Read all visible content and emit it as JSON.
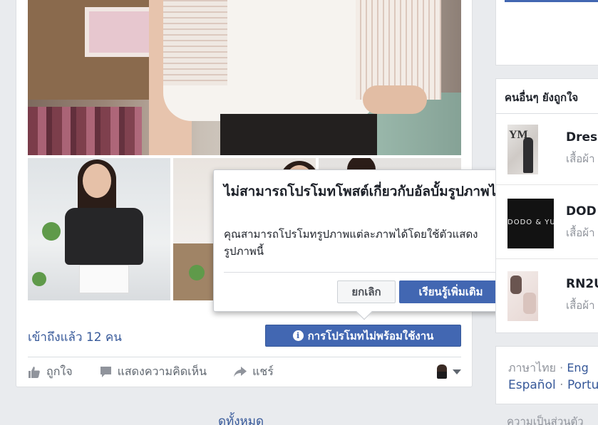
{
  "post": {
    "reach_text": "เข้าถึงแล้ว 12 คน",
    "promote_button": "การโปรโมทไม่พร้อมใช้งาน",
    "actions": {
      "like": "ถูกใจ",
      "comment": "แสดงความคิดเห็น",
      "share": "แชร์"
    },
    "see_all": "ดูทั้งหมด"
  },
  "popover": {
    "title": "ไม่สามารถโปรโมทโพสต์เกี่ยวกับอัลบั้มรูปภาพได้",
    "body": "คุณสามารถโปรโมทรูปภาพแต่ละภาพได้โดยใช้ตัวแสดงรูปภาพนี้",
    "cancel": "ยกเลิก",
    "learn_more": "เรียนรู้เพิ่มเติม"
  },
  "sidebar": {
    "pages_header": "คนอื่นๆ ยังถูกใจ",
    "pages": [
      {
        "name": "Dres",
        "sub": "เสื้อผ้า",
        "thumb_text": "YM"
      },
      {
        "name": "DOD",
        "sub": "เสื้อผ้า",
        "thumb_text": "DODO & YU"
      },
      {
        "name": "RN2U",
        "sub": "เสื้อผ้า"
      }
    ],
    "languages": {
      "current": "ภาษาไทย",
      "sep": "·",
      "eng": "Eng",
      "espanol": "Español",
      "portu": "Portu"
    },
    "privacy": "ความเป็นส่วนตัว"
  },
  "colors": {
    "brand_blue": "#4267b2",
    "link_blue": "#365899",
    "bg": "#e9ebee"
  }
}
